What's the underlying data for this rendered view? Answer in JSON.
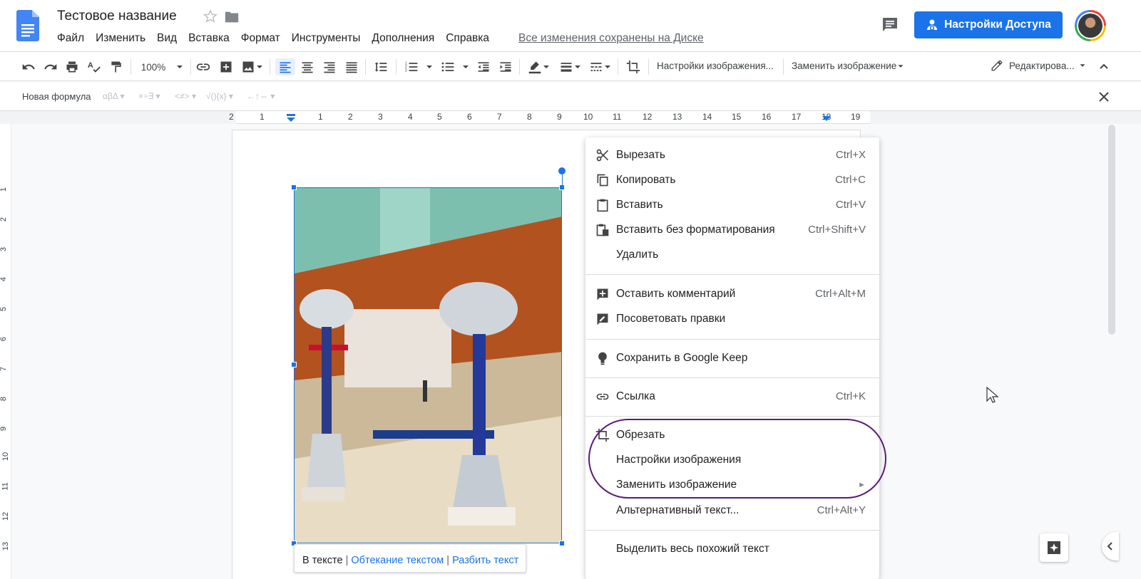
{
  "header": {
    "title": "Тестовое название",
    "menu": [
      "Файл",
      "Изменить",
      "Вид",
      "Вставка",
      "Формат",
      "Инструменты",
      "Дополнения",
      "Справка"
    ],
    "saved_status": "Все изменения сохранены на Диске",
    "share_label": "Настройки Доступа"
  },
  "toolbar": {
    "zoom": "100%",
    "image_options": "Настройки изображения...",
    "replace_image": "Заменить изображение",
    "editing_mode": "Редактирова..."
  },
  "equation_bar": {
    "new_formula": "Новая формула",
    "groups": [
      "αβΔ",
      "×÷∃",
      "<≠>",
      "√(){x}",
      "←↑⇔"
    ]
  },
  "ruler": {
    "numbers": [
      "2",
      "1",
      "1",
      "2",
      "3",
      "4",
      "5",
      "6",
      "7",
      "8",
      "9",
      "10",
      "11",
      "12",
      "13",
      "14",
      "15",
      "16",
      "17",
      "18",
      "19"
    ],
    "vertical_numbers": [
      "1",
      "2",
      "3",
      "4",
      "5",
      "6",
      "7",
      "8",
      "9",
      "10",
      "11",
      "12",
      "13"
    ]
  },
  "image_toolbar": {
    "inline": "В тексте",
    "wrap": "Обтекание текстом",
    "break": "Разбить текст",
    "separator": "|"
  },
  "context_menu": {
    "items": [
      {
        "icon": "scissors-icon",
        "label": "Вырезать",
        "shortcut": "Ctrl+X"
      },
      {
        "icon": "copy-icon",
        "label": "Копировать",
        "shortcut": "Ctrl+C"
      },
      {
        "icon": "clipboard-icon",
        "label": "Вставить",
        "shortcut": "Ctrl+V"
      },
      {
        "icon": "paste-plain-icon",
        "label": "Вставить без форматирования",
        "shortcut": "Ctrl+Shift+V"
      },
      {
        "icon": "",
        "label": "Удалить",
        "shortcut": ""
      },
      {
        "icon": "add-comment-icon",
        "label": "Оставить комментарий",
        "shortcut": "Ctrl+Alt+M"
      },
      {
        "icon": "suggest-edit-icon",
        "label": "Посоветовать правки",
        "shortcut": ""
      },
      {
        "icon": "lightbulb-icon",
        "label": "Сохранить в Google Keep",
        "shortcut": ""
      },
      {
        "icon": "link-icon",
        "label": "Ссылка",
        "shortcut": "Ctrl+K"
      },
      {
        "icon": "crop-icon",
        "label": "Обрезать",
        "shortcut": ""
      },
      {
        "icon": "",
        "label": "Настройки изображения",
        "shortcut": ""
      },
      {
        "icon": "",
        "label": "Заменить изображение",
        "shortcut": "►"
      },
      {
        "icon": "",
        "label": "Альтернативный текст...",
        "shortcut": "Ctrl+Alt+Y"
      },
      {
        "icon": "",
        "label": "Выделить весь похожий текст",
        "shortcut": ""
      }
    ]
  },
  "colors": {
    "accent": "#1a73e8",
    "highlight_ring": "#5b1a7a"
  }
}
